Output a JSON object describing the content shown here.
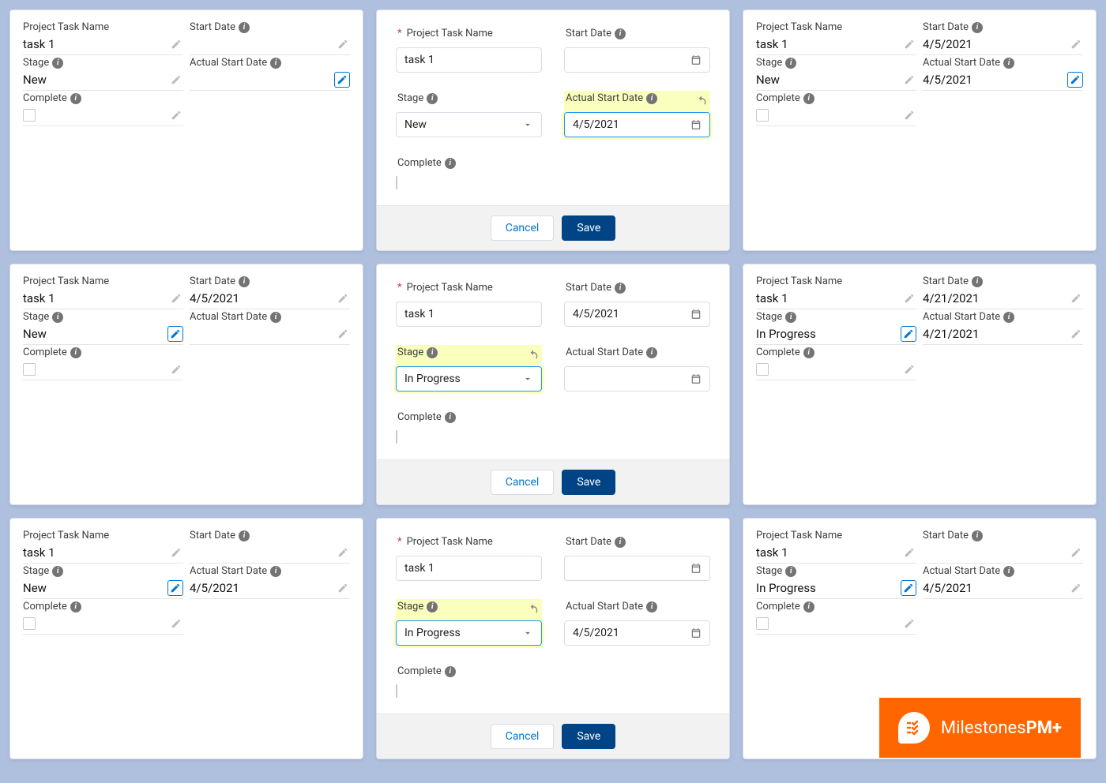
{
  "labels": {
    "project_task_name": "Project Task Name",
    "start_date": "Start Date",
    "stage": "Stage",
    "actual_start_date": "Actual Start Date",
    "complete": "Complete",
    "cancel": "Cancel",
    "save": "Save"
  },
  "branding": {
    "name_left": "Milestones",
    "name_right": "PM+"
  },
  "cards": [
    {
      "mode": "view",
      "task_name": "task 1",
      "stage": "New",
      "start_date": "",
      "actual_start_date": "",
      "active_pencil": "actual_start_date"
    },
    {
      "mode": "edit",
      "task_name": "task 1",
      "stage": "New",
      "start_date": "",
      "actual_start_date": "4/5/2021",
      "edited_field": "actual_start_date"
    },
    {
      "mode": "view",
      "task_name": "task 1",
      "stage": "New",
      "start_date": "4/5/2021",
      "actual_start_date": "4/5/2021",
      "active_pencil": "actual_start_date"
    },
    {
      "mode": "view",
      "task_name": "task 1",
      "stage": "New",
      "start_date": "4/5/2021",
      "actual_start_date": "",
      "active_pencil": "stage"
    },
    {
      "mode": "edit",
      "task_name": "task 1",
      "stage": "In Progress",
      "start_date": "4/5/2021",
      "actual_start_date": "",
      "edited_field": "stage"
    },
    {
      "mode": "view",
      "task_name": "task 1",
      "stage": "In Progress",
      "start_date": "4/21/2021",
      "actual_start_date": "4/21/2021",
      "active_pencil": "stage"
    },
    {
      "mode": "view",
      "task_name": "task 1",
      "stage": "New",
      "start_date": "",
      "actual_start_date": "4/5/2021",
      "active_pencil": "stage"
    },
    {
      "mode": "edit",
      "task_name": "task 1",
      "stage": "In Progress",
      "start_date": "",
      "actual_start_date": "4/5/2021",
      "edited_field": "stage"
    },
    {
      "mode": "view",
      "task_name": "task 1",
      "stage": "In Progress",
      "start_date": "",
      "actual_start_date": "4/5/2021",
      "active_pencil": "stage"
    }
  ]
}
